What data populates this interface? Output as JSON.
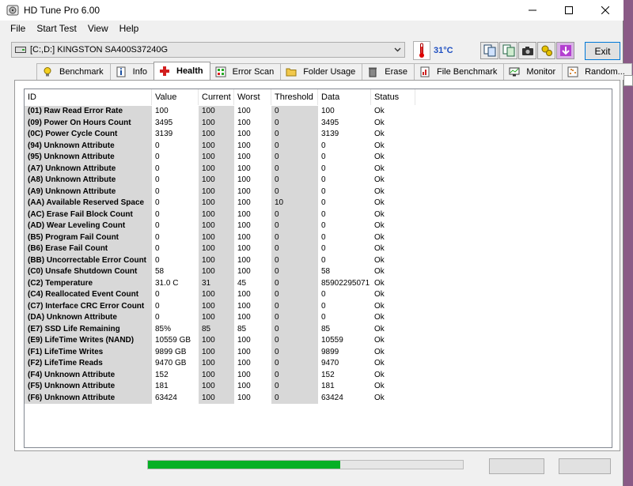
{
  "window": {
    "title": "HD Tune Pro 6.00"
  },
  "menu": [
    "File",
    "Start Test",
    "View",
    "Help"
  ],
  "toolbar": {
    "drive": "[C:,D:] KINGSTON SA400S37240G",
    "temperature": "31°C",
    "exit_label": "Exit",
    "tool_icons": [
      "copy-info-icon",
      "copy-text-icon",
      "screenshot-icon",
      "options-icon",
      "save-icon"
    ]
  },
  "tabs": [
    {
      "label": "Benchmark",
      "icon": "bulb-icon",
      "active": false
    },
    {
      "label": "Info",
      "icon": "info-icon",
      "active": false
    },
    {
      "label": "Health",
      "icon": "health-cross-icon",
      "active": true
    },
    {
      "label": "Error Scan",
      "icon": "error-scan-icon",
      "active": false
    },
    {
      "label": "Folder Usage",
      "icon": "folder-icon",
      "active": false
    },
    {
      "label": "Erase",
      "icon": "trash-icon",
      "active": false
    },
    {
      "label": "File Benchmark",
      "icon": "file-benchmark-icon",
      "active": false
    },
    {
      "label": "Monitor",
      "icon": "monitor-icon",
      "active": false
    },
    {
      "label": "Random...",
      "icon": "random-icon",
      "active": false
    }
  ],
  "table": {
    "columns": [
      "ID",
      "Value",
      "Current",
      "Worst",
      "Threshold",
      "Data",
      "Status"
    ],
    "rows": [
      [
        "(01) Raw Read Error Rate",
        "100",
        "100",
        "100",
        "0",
        "100",
        "Ok"
      ],
      [
        "(09) Power On Hours Count",
        "3495",
        "100",
        "100",
        "0",
        "3495",
        "Ok"
      ],
      [
        "(0C) Power Cycle Count",
        "3139",
        "100",
        "100",
        "0",
        "3139",
        "Ok"
      ],
      [
        "(94) Unknown Attribute",
        "0",
        "100",
        "100",
        "0",
        "0",
        "Ok"
      ],
      [
        "(95) Unknown Attribute",
        "0",
        "100",
        "100",
        "0",
        "0",
        "Ok"
      ],
      [
        "(A7) Unknown Attribute",
        "0",
        "100",
        "100",
        "0",
        "0",
        "Ok"
      ],
      [
        "(A8) Unknown Attribute",
        "0",
        "100",
        "100",
        "0",
        "0",
        "Ok"
      ],
      [
        "(A9) Unknown Attribute",
        "0",
        "100",
        "100",
        "0",
        "0",
        "Ok"
      ],
      [
        "(AA) Available Reserved Space",
        "0",
        "100",
        "100",
        "10",
        "0",
        "Ok"
      ],
      [
        "(AC) Erase Fail Block Count",
        "0",
        "100",
        "100",
        "0",
        "0",
        "Ok"
      ],
      [
        "(AD) Wear Leveling Count",
        "0",
        "100",
        "100",
        "0",
        "0",
        "Ok"
      ],
      [
        "(B5) Program Fail Count",
        "0",
        "100",
        "100",
        "0",
        "0",
        "Ok"
      ],
      [
        "(B6) Erase Fail Count",
        "0",
        "100",
        "100",
        "0",
        "0",
        "Ok"
      ],
      [
        "(BB) Uncorrectable Error Count",
        "0",
        "100",
        "100",
        "0",
        "0",
        "Ok"
      ],
      [
        "(C0) Unsafe Shutdown Count",
        "58",
        "100",
        "100",
        "0",
        "58",
        "Ok"
      ],
      [
        "(C2) Temperature",
        "31.0 C",
        "31",
        "45",
        "0",
        "85902295071",
        "Ok"
      ],
      [
        "(C4) Reallocated Event Count",
        "0",
        "100",
        "100",
        "0",
        "0",
        "Ok"
      ],
      [
        "(C7) Interface CRC Error Count",
        "0",
        "100",
        "100",
        "0",
        "0",
        "Ok"
      ],
      [
        "(DA) Unknown Attribute",
        "0",
        "100",
        "100",
        "0",
        "0",
        "Ok"
      ],
      [
        "(E7) SSD Life Remaining",
        "85%",
        "85",
        "85",
        "0",
        "85",
        "Ok"
      ],
      [
        "(E9) LifeTime Writes (NAND)",
        "10559 GB",
        "100",
        "100",
        "0",
        "10559",
        "Ok"
      ],
      [
        "(F1) LifeTime Writes",
        "9899 GB",
        "100",
        "100",
        "0",
        "9899",
        "Ok"
      ],
      [
        "(F2) LifeTime Reads",
        "9470 GB",
        "100",
        "100",
        "0",
        "9470",
        "Ok"
      ],
      [
        "(F4) Unknown Attribute",
        "152",
        "100",
        "100",
        "0",
        "152",
        "Ok"
      ],
      [
        "(F5) Unknown Attribute",
        "181",
        "100",
        "100",
        "0",
        "181",
        "Ok"
      ],
      [
        "(F6) Unknown Attribute",
        "63424",
        "100",
        "100",
        "0",
        "63424",
        "Ok"
      ]
    ]
  },
  "status_bar": {
    "progress_fraction": 0.61
  },
  "colors": {
    "progress": "#06b025",
    "temperature_text": "#1e4fc1",
    "id_column_bg": "#d8d8d8"
  }
}
